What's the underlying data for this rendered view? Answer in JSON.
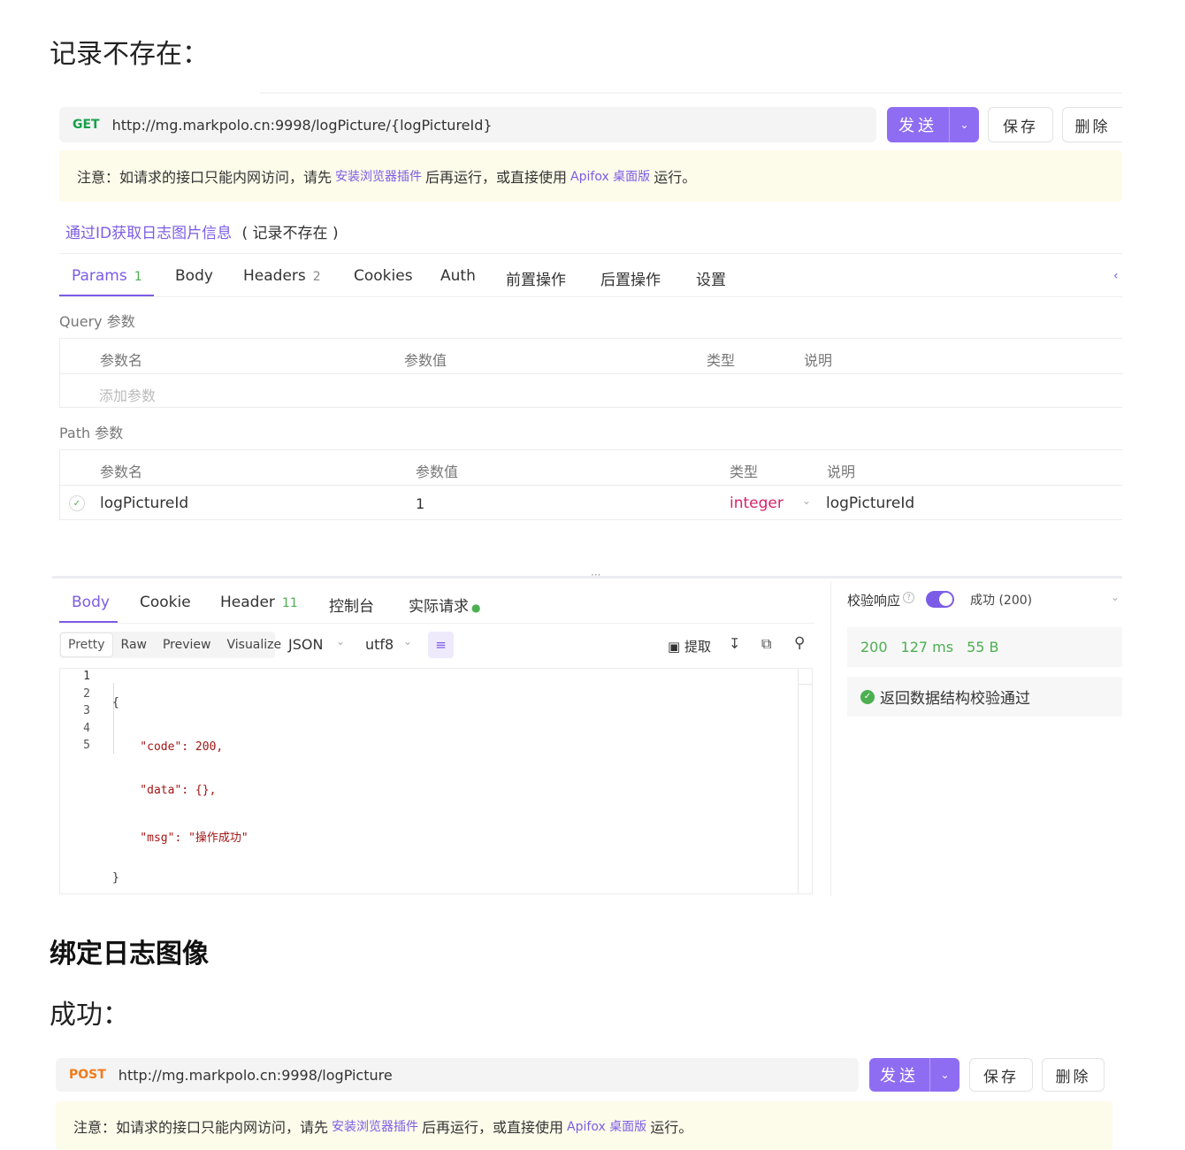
{
  "section1": {
    "heading": "记录不存在："
  },
  "req1": {
    "method": "GET",
    "url": "http://mg.markpolo.cn:9998/logPicture/{logPictureId}",
    "send_label": "发送",
    "save_label": "保存",
    "delete_label": "删除"
  },
  "notice": {
    "before": "注意：如请求的接口只能内网访问，请先",
    "link1": "安装浏览器插件",
    "middle": "后再运行，或直接使用",
    "link2": "Apifox 桌面版",
    "after": "运行。"
  },
  "api": {
    "name": "通过ID获取日志图片信息",
    "case": "( 记录不存在 )"
  },
  "tabs": [
    {
      "label": "Params",
      "count": "1"
    },
    {
      "label": "Body",
      "count": ""
    },
    {
      "label": "Headers",
      "count": "2"
    },
    {
      "label": "Cookies",
      "count": ""
    },
    {
      "label": "Auth",
      "count": ""
    },
    {
      "label": "前置操作",
      "count": ""
    },
    {
      "label": "后置操作",
      "count": ""
    },
    {
      "label": "设置",
      "count": ""
    }
  ],
  "query": {
    "title": "Query 参数",
    "headers": [
      "参数名",
      "参数值",
      "类型",
      "说明"
    ],
    "add_placeholder": "添加参数"
  },
  "path": {
    "title": "Path 参数",
    "headers": [
      "参数名",
      "参数值",
      "类型",
      "说明"
    ],
    "row": {
      "name": "logPictureId",
      "value": "1",
      "type": "integer",
      "desc": "logPictureId"
    }
  },
  "resp_tabs": [
    {
      "label": "Body",
      "count": ""
    },
    {
      "label": "Cookie",
      "count": ""
    },
    {
      "label": "Header",
      "count": "11"
    },
    {
      "label": "控制台",
      "count": ""
    },
    {
      "label": "实际请求",
      "count": ""
    }
  ],
  "toolbar": {
    "views": [
      "Pretty",
      "Raw",
      "Preview",
      "Visualize"
    ],
    "format": "JSON",
    "encoding": "utf8",
    "extract": "提取"
  },
  "code_lines": [
    {
      "n": "1",
      "text": "{"
    },
    {
      "n": "2",
      "text": "    \"code\": 200,"
    },
    {
      "n": "3",
      "text": "    \"data\": {},"
    },
    {
      "n": "4",
      "text": "    \"msg\": \"操作成功\""
    },
    {
      "n": "5",
      "text": "}"
    }
  ],
  "validate": {
    "label": "校验响应",
    "result": "成功 (200)",
    "status": "200",
    "time": "127 ms",
    "size": "55 B",
    "passed": "返回数据结构校验通过"
  },
  "section2": {
    "heading": "绑定日志图像",
    "sub": "成功："
  },
  "req2": {
    "method": "POST",
    "url": "http://mg.markpolo.cn:9998/logPicture",
    "send_label": "发送",
    "save_label": "保存",
    "delete_label": "删除"
  },
  "colors": {
    "accent": "#7c5ce6",
    "send": "#8f6df2",
    "get": "#17a04a",
    "post": "#f07b1a",
    "integer": "#d6226a"
  }
}
